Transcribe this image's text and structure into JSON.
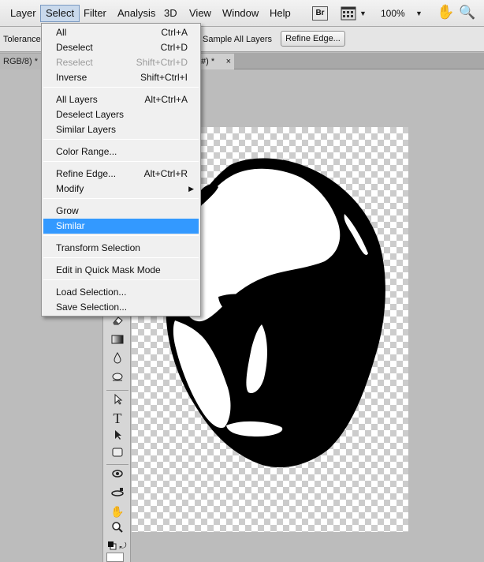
{
  "menubar": {
    "items": [
      {
        "label": "Layer"
      },
      {
        "label": "Select"
      },
      {
        "label": "Filter"
      },
      {
        "label": "Analysis"
      },
      {
        "label": "3D"
      },
      {
        "label": "View"
      },
      {
        "label": "Window"
      },
      {
        "label": "Help"
      }
    ],
    "bridge_label": "Br",
    "zoom": "100%"
  },
  "options": {
    "tolerance_label": "Tolerance:",
    "sample_all_layers": "Sample All Layers",
    "refine_edge_button": "Refine Edge..."
  },
  "tabs": {
    "left": "RGB/8) *",
    "right": "#) *",
    "close": "×"
  },
  "select_menu": {
    "items": [
      {
        "label": "All",
        "shortcut": "Ctrl+A"
      },
      {
        "label": "Deselect",
        "shortcut": "Ctrl+D"
      },
      {
        "label": "Reselect",
        "shortcut": "Shift+Ctrl+D",
        "disabled": true
      },
      {
        "label": "Inverse",
        "shortcut": "Shift+Ctrl+I"
      },
      {
        "label": "All Layers",
        "shortcut": "Alt+Ctrl+A"
      },
      {
        "label": "Deselect Layers",
        "shortcut": ""
      },
      {
        "label": "Similar Layers",
        "shortcut": ""
      },
      {
        "label": "Color Range...",
        "shortcut": ""
      },
      {
        "label": "Refine Edge...",
        "shortcut": "Alt+Ctrl+R"
      },
      {
        "label": "Modify",
        "shortcut": "",
        "submenu": true
      },
      {
        "label": "Grow",
        "shortcut": ""
      },
      {
        "label": "Similar",
        "shortcut": "",
        "highlighted": true
      },
      {
        "label": "Transform Selection",
        "shortcut": ""
      },
      {
        "label": "Edit in Quick Mask Mode",
        "shortcut": ""
      },
      {
        "label": "Load Selection...",
        "shortcut": ""
      },
      {
        "label": "Save Selection...",
        "shortcut": ""
      }
    ]
  },
  "icons": {
    "hand": "hand-tool-icon",
    "zoom": "zoom-tool-icon",
    "type_tool_glyph": "T"
  },
  "colors": {
    "highlight": "#3399ff",
    "menubar_active": "#c9d9ec"
  }
}
